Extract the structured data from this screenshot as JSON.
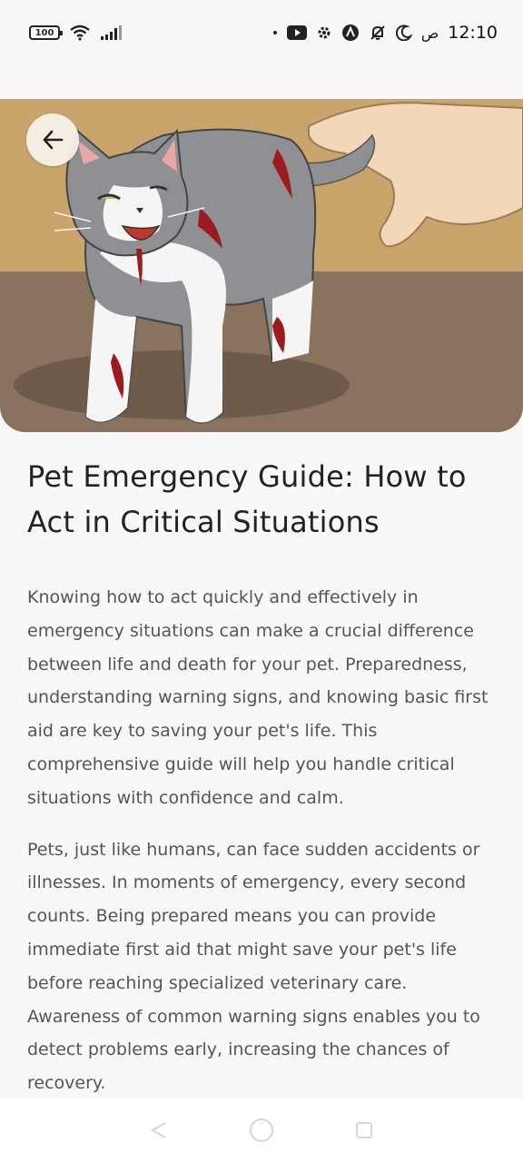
{
  "status_bar": {
    "battery_level": "100",
    "time": "12:10",
    "ampm": "ص"
  },
  "hero": {
    "image_alt_icon": "injured-cat-illustration"
  },
  "article": {
    "title": "Pet Emergency Guide: How to Act in Critical Situations",
    "paragraphs": [
      "Knowing how to act quickly and effectively in emergency situations can make a crucial difference between life and death for your pet. Preparedness, understanding warning signs, and knowing basic first aid are key to saving your pet's life. This comprehensive guide will help you handle critical situations with confidence and calm.",
      "Pets, just like humans, can face sudden accidents or illnesses. In moments of emergency, every second counts. Being prepared means you can provide immediate first aid that might save your pet's life before reaching specialized veterinary care. Awareness of common warning signs enables you to detect problems early, increasing the chances of recovery."
    ]
  },
  "colors": {
    "background": "#faf8f6",
    "hero_wall": "#c9a46b",
    "hero_floor": "#8a735e"
  }
}
